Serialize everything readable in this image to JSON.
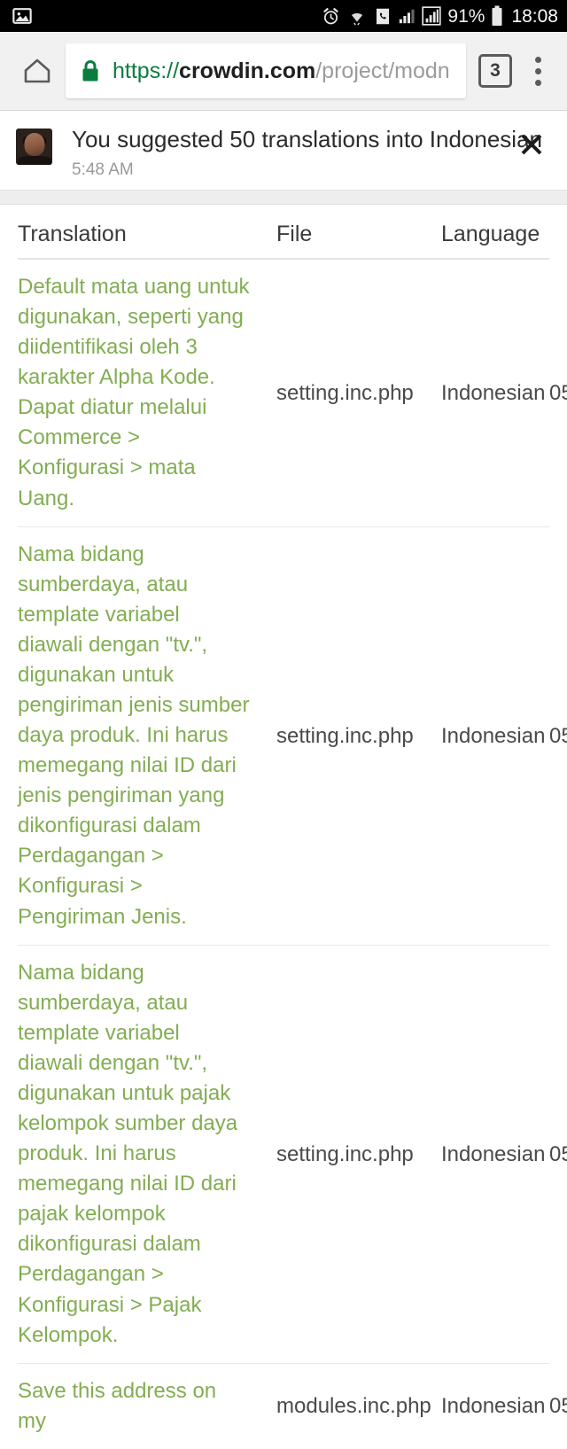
{
  "status_bar": {
    "notification_icon": "image-icon",
    "alarm_icon": "alarm-clock-icon",
    "wifi_icon": "wifi-icon",
    "call_icon": "phone-icon",
    "signal1_icon": "signal-bars-icon",
    "signal2_icon": "signal-bars-boxed-icon",
    "battery_percent": "91%",
    "battery_icon": "battery-icon",
    "time": "18:08"
  },
  "browser": {
    "home_icon": "home-icon",
    "lock_icon": "lock-icon",
    "url_scheme": "https://",
    "url_host": "crowdin.com",
    "url_path": "/project/modn",
    "tab_count": "3",
    "menu_icon": "overflow-menu-icon"
  },
  "notification": {
    "avatar_label": "user-avatar",
    "title": "You suggested 50 translations into Indonesian",
    "time": "5:48 AM",
    "close_icon": "close-icon"
  },
  "table": {
    "headers": {
      "translation": "Translation",
      "file": "File",
      "language": "Language",
      "date": ""
    },
    "rows": [
      {
        "translation": "Default mata uang untuk digunakan, seperti yang diidentifikasi oleh 3 karakter Alpha Kode. Dapat diatur melalui Commerce > Konfigurasi > mata Uang.",
        "file": "setting.inc.php",
        "language": "Indonesian",
        "date": "05"
      },
      {
        "translation": "Nama bidang sumberdaya, atau template variabel diawali dengan \"tv.\", digunakan untuk pengiriman jenis sumber daya produk. Ini harus memegang nilai ID dari jenis pengiriman yang dikonfigurasi dalam Perdagangan > Konfigurasi > Pengiriman Jenis.",
        "file": "setting.inc.php",
        "language": "Indonesian",
        "date": "05"
      },
      {
        "translation": "Nama bidang sumberdaya, atau template variabel diawali dengan \"tv.\", digunakan untuk pajak kelompok sumber daya produk. Ini harus memegang nilai ID dari pajak kelompok dikonfigurasi dalam Perdagangan > Konfigurasi > Pajak Kelompok.",
        "file": "setting.inc.php",
        "language": "Indonesian",
        "date": "05"
      },
      {
        "translation": "Save this address on my",
        "file": "modules.inc.php",
        "language": "Indonesian",
        "date": "05"
      }
    ]
  },
  "colors": {
    "translation_green": "#83ad53",
    "url_green": "#0a7d3e",
    "status_bar_bg": "#000000",
    "chrome_bg": "#f1f1f1"
  }
}
